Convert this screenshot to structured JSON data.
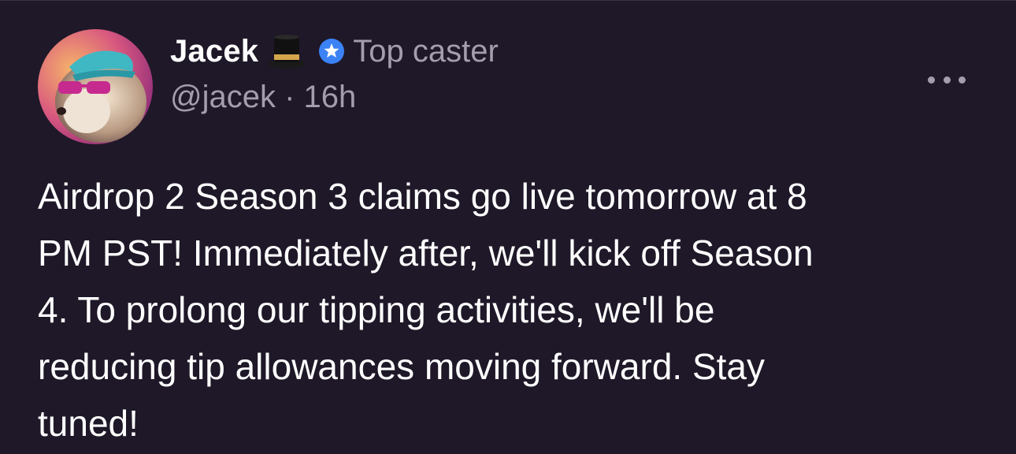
{
  "author": {
    "display_name": "Jacek",
    "badge_label": "Top caster",
    "handle": "@jacek",
    "separator": "·",
    "time_ago": "16h",
    "name_emoji_icon": "top-hat-icon",
    "badge_icon": "star-badge-icon"
  },
  "post": {
    "lines": [
      "Airdrop 2 Season 3 claims go live tomorrow at 8",
      "PM PST! Immediately after, we'll kick off Season",
      "4. To prolong our tipping activities, we'll be",
      "reducing tip allowances moving forward. Stay",
      "tuned!"
    ]
  },
  "actions": {
    "more_icon": "more-horizontal-icon"
  },
  "colors": {
    "background": "#1f1828",
    "text_primary": "#ffffff",
    "text_secondary": "#a39dae",
    "badge_blue": "#3b82f6"
  }
}
